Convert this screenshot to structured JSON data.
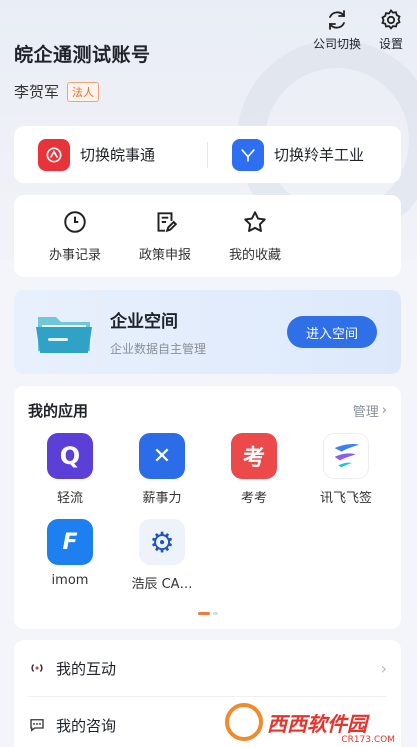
{
  "header": {
    "account_title": "皖企通测试账号",
    "user_name": "李贺军",
    "role_badge": "法人",
    "switch_company_label": "公司切换",
    "settings_label": "设置"
  },
  "switch_apps": [
    {
      "label": "切换皖事通",
      "icon": "wanshitong-logo",
      "color": "#e8333a"
    },
    {
      "label": "切换羚羊工业",
      "icon": "lingyang-logo",
      "color": "#2d6ff0"
    }
  ],
  "quick_actions": [
    {
      "label": "办事记录",
      "icon": "clock-icon"
    },
    {
      "label": "政策申报",
      "icon": "document-edit-icon"
    },
    {
      "label": "我的收藏",
      "icon": "star-icon"
    }
  ],
  "enterprise_space": {
    "title": "企业空间",
    "subtitle": "企业数据自主管理",
    "button_label": "进入空间"
  },
  "my_apps": {
    "title": "我的应用",
    "manage_label": "管理",
    "apps": [
      {
        "label": "轻流",
        "icon": "qingliu-icon",
        "glyph": "Q",
        "color": "#5b3fd6"
      },
      {
        "label": "薪事力",
        "icon": "xinshili-icon",
        "glyph": "✕",
        "color": "#2b6de8"
      },
      {
        "label": "考考",
        "icon": "kaokao-icon",
        "glyph": "考",
        "color": "#ec4a4a"
      },
      {
        "label": "讯飞飞签",
        "icon": "xunfei-feiqian-icon",
        "glyph": "",
        "color": "#ffffff"
      },
      {
        "label": "imom",
        "icon": "imom-icon",
        "glyph": "F",
        "color": "#1e7ff0"
      },
      {
        "label": "浩辰 CA…",
        "icon": "haochen-cad-icon",
        "glyph": "⚙",
        "color": "#eef3fb"
      }
    ]
  },
  "list": [
    {
      "label": "我的互动",
      "icon": "interaction-icon"
    },
    {
      "label": "我的咨询",
      "icon": "consult-icon"
    }
  ],
  "watermark_site": {
    "name": "西西软件园",
    "url": "CR173.COM"
  }
}
